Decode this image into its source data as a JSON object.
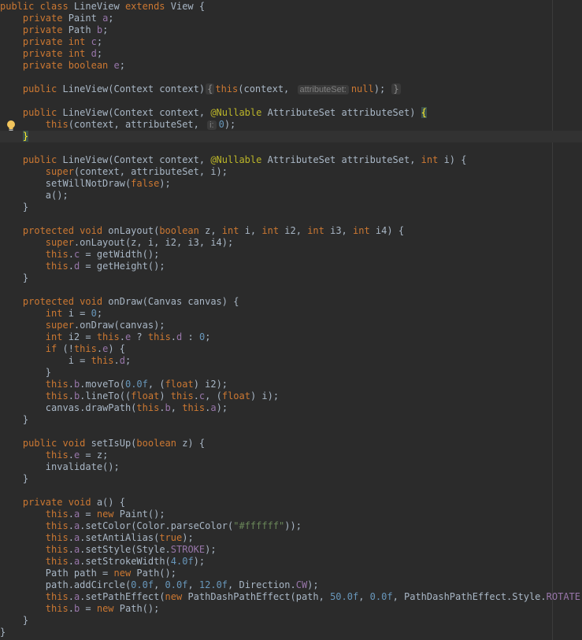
{
  "editor": {
    "hint_icon": "lightbulb-icon",
    "lines": [
      {
        "segs": [
          {
            "t": "public class ",
            "c": "kw"
          },
          {
            "t": "LineView "
          },
          {
            "t": "extends ",
            "c": "kw"
          },
          {
            "t": "View {"
          }
        ]
      },
      {
        "segs": [
          {
            "t": "    "
          },
          {
            "t": "private ",
            "c": "kw"
          },
          {
            "t": "Paint "
          },
          {
            "t": "a",
            "c": "fld"
          },
          {
            "t": ";"
          }
        ]
      },
      {
        "segs": [
          {
            "t": "    "
          },
          {
            "t": "private ",
            "c": "kw"
          },
          {
            "t": "Path "
          },
          {
            "t": "b",
            "c": "fld"
          },
          {
            "t": ";"
          }
        ]
      },
      {
        "segs": [
          {
            "t": "    "
          },
          {
            "t": "private int ",
            "c": "kw"
          },
          {
            "t": "c",
            "c": "fld"
          },
          {
            "t": ";"
          }
        ]
      },
      {
        "segs": [
          {
            "t": "    "
          },
          {
            "t": "private int ",
            "c": "kw"
          },
          {
            "t": "d",
            "c": "fld"
          },
          {
            "t": ";"
          }
        ]
      },
      {
        "segs": [
          {
            "t": "    "
          },
          {
            "t": "private boolean ",
            "c": "kw"
          },
          {
            "t": "e",
            "c": "fld"
          },
          {
            "t": ";"
          }
        ]
      },
      {
        "segs": []
      },
      {
        "segs": [
          {
            "t": "    "
          },
          {
            "t": "public ",
            "c": "kw"
          },
          {
            "t": "LineView(Context context)"
          },
          {
            "t": "{",
            "c": "fold"
          },
          {
            "t": "this",
            "c": "kw"
          },
          {
            "t": "(context, "
          },
          {
            "t": "attributeSet:",
            "c": "hint"
          },
          {
            "t": "null",
            "c": "kw"
          },
          {
            "t": "); "
          },
          {
            "t": "}",
            "c": "fold"
          }
        ]
      },
      {
        "segs": []
      },
      {
        "segs": [
          {
            "t": "    "
          },
          {
            "t": "public ",
            "c": "kw"
          },
          {
            "t": "LineView(Context context, "
          },
          {
            "t": "@Nullable ",
            "c": "ann"
          },
          {
            "t": "AttributeSet attributeSet) "
          },
          {
            "t": "{",
            "c": "brace-hl"
          }
        ]
      },
      {
        "segs": [
          {
            "t": "        "
          },
          {
            "t": "this",
            "c": "kw"
          },
          {
            "t": "(context, attributeSet, "
          },
          {
            "t": "i:",
            "c": "hint"
          },
          {
            "t": "0",
            "c": "num"
          },
          {
            "t": ");"
          }
        ]
      },
      {
        "segs": [
          {
            "t": "    "
          },
          {
            "t": "}",
            "c": "brace-hl"
          }
        ],
        "current": true
      },
      {
        "segs": []
      },
      {
        "segs": [
          {
            "t": "    "
          },
          {
            "t": "public ",
            "c": "kw"
          },
          {
            "t": "LineView(Context context, "
          },
          {
            "t": "@Nullable ",
            "c": "ann"
          },
          {
            "t": "AttributeSet attributeSet, "
          },
          {
            "t": "int ",
            "c": "kw"
          },
          {
            "t": "i) {"
          }
        ]
      },
      {
        "segs": [
          {
            "t": "        "
          },
          {
            "t": "super",
            "c": "kw"
          },
          {
            "t": "(context, attributeSet, i);"
          }
        ]
      },
      {
        "segs": [
          {
            "t": "        "
          },
          {
            "t": "setWillNotDraw("
          },
          {
            "t": "false",
            "c": "kw"
          },
          {
            "t": ");"
          }
        ]
      },
      {
        "segs": [
          {
            "t": "        "
          },
          {
            "t": "a();"
          }
        ]
      },
      {
        "segs": [
          {
            "t": "    }"
          }
        ]
      },
      {
        "segs": []
      },
      {
        "segs": [
          {
            "t": "    "
          },
          {
            "t": "protected void ",
            "c": "kw"
          },
          {
            "t": "onLayout("
          },
          {
            "t": "boolean ",
            "c": "kw"
          },
          {
            "t": "z, "
          },
          {
            "t": "int ",
            "c": "kw"
          },
          {
            "t": "i, "
          },
          {
            "t": "int ",
            "c": "kw"
          },
          {
            "t": "i2, "
          },
          {
            "t": "int ",
            "c": "kw"
          },
          {
            "t": "i3, "
          },
          {
            "t": "int ",
            "c": "kw"
          },
          {
            "t": "i4) {"
          }
        ]
      },
      {
        "segs": [
          {
            "t": "        "
          },
          {
            "t": "super",
            "c": "kw"
          },
          {
            "t": ".onLayout(z, i, i2, i3, i4);"
          }
        ]
      },
      {
        "segs": [
          {
            "t": "        "
          },
          {
            "t": "this",
            "c": "kw"
          },
          {
            "t": "."
          },
          {
            "t": "c",
            "c": "fld"
          },
          {
            "t": " = getWidth();"
          }
        ]
      },
      {
        "segs": [
          {
            "t": "        "
          },
          {
            "t": "this",
            "c": "kw"
          },
          {
            "t": "."
          },
          {
            "t": "d",
            "c": "fld"
          },
          {
            "t": " = getHeight();"
          }
        ]
      },
      {
        "segs": [
          {
            "t": "    }"
          }
        ]
      },
      {
        "segs": []
      },
      {
        "segs": [
          {
            "t": "    "
          },
          {
            "t": "protected void ",
            "c": "kw"
          },
          {
            "t": "onDraw(Canvas canvas) {"
          }
        ]
      },
      {
        "segs": [
          {
            "t": "        "
          },
          {
            "t": "int ",
            "c": "kw"
          },
          {
            "t": "i = "
          },
          {
            "t": "0",
            "c": "num"
          },
          {
            "t": ";"
          }
        ]
      },
      {
        "segs": [
          {
            "t": "        "
          },
          {
            "t": "super",
            "c": "kw"
          },
          {
            "t": ".onDraw(canvas);"
          }
        ]
      },
      {
        "segs": [
          {
            "t": "        "
          },
          {
            "t": "int ",
            "c": "kw"
          },
          {
            "t": "i2 = "
          },
          {
            "t": "this",
            "c": "kw"
          },
          {
            "t": "."
          },
          {
            "t": "e",
            "c": "fld"
          },
          {
            "t": " ? "
          },
          {
            "t": "this",
            "c": "kw"
          },
          {
            "t": "."
          },
          {
            "t": "d",
            "c": "fld"
          },
          {
            "t": " : "
          },
          {
            "t": "0",
            "c": "num"
          },
          {
            "t": ";"
          }
        ]
      },
      {
        "segs": [
          {
            "t": "        "
          },
          {
            "t": "if ",
            "c": "kw"
          },
          {
            "t": "(!"
          },
          {
            "t": "this",
            "c": "kw"
          },
          {
            "t": "."
          },
          {
            "t": "e",
            "c": "fld"
          },
          {
            "t": ") {"
          }
        ]
      },
      {
        "segs": [
          {
            "t": "            i = "
          },
          {
            "t": "this",
            "c": "kw"
          },
          {
            "t": "."
          },
          {
            "t": "d",
            "c": "fld"
          },
          {
            "t": ";"
          }
        ]
      },
      {
        "segs": [
          {
            "t": "        }"
          }
        ]
      },
      {
        "segs": [
          {
            "t": "        "
          },
          {
            "t": "this",
            "c": "kw"
          },
          {
            "t": "."
          },
          {
            "t": "b",
            "c": "fld"
          },
          {
            "t": ".moveTo("
          },
          {
            "t": "0.0f",
            "c": "num"
          },
          {
            "t": ", ("
          },
          {
            "t": "float",
            "c": "kw"
          },
          {
            "t": ") i2);"
          }
        ]
      },
      {
        "segs": [
          {
            "t": "        "
          },
          {
            "t": "this",
            "c": "kw"
          },
          {
            "t": "."
          },
          {
            "t": "b",
            "c": "fld"
          },
          {
            "t": ".lineTo(("
          },
          {
            "t": "float",
            "c": "kw"
          },
          {
            "t": ") "
          },
          {
            "t": "this",
            "c": "kw"
          },
          {
            "t": "."
          },
          {
            "t": "c",
            "c": "fld"
          },
          {
            "t": ", ("
          },
          {
            "t": "float",
            "c": "kw"
          },
          {
            "t": ") i);"
          }
        ]
      },
      {
        "segs": [
          {
            "t": "        canvas.drawPath("
          },
          {
            "t": "this",
            "c": "kw"
          },
          {
            "t": "."
          },
          {
            "t": "b",
            "c": "fld"
          },
          {
            "t": ", "
          },
          {
            "t": "this",
            "c": "kw"
          },
          {
            "t": "."
          },
          {
            "t": "a",
            "c": "fld"
          },
          {
            "t": ");"
          }
        ]
      },
      {
        "segs": [
          {
            "t": "    }"
          }
        ]
      },
      {
        "segs": []
      },
      {
        "segs": [
          {
            "t": "    "
          },
          {
            "t": "public void ",
            "c": "kw"
          },
          {
            "t": "setIsUp("
          },
          {
            "t": "boolean ",
            "c": "kw"
          },
          {
            "t": "z) {"
          }
        ]
      },
      {
        "segs": [
          {
            "t": "        "
          },
          {
            "t": "this",
            "c": "kw"
          },
          {
            "t": "."
          },
          {
            "t": "e",
            "c": "fld"
          },
          {
            "t": " = z;"
          }
        ]
      },
      {
        "segs": [
          {
            "t": "        invalidate();"
          }
        ]
      },
      {
        "segs": [
          {
            "t": "    }"
          }
        ]
      },
      {
        "segs": []
      },
      {
        "segs": [
          {
            "t": "    "
          },
          {
            "t": "private void ",
            "c": "kw"
          },
          {
            "t": "a() {"
          }
        ]
      },
      {
        "segs": [
          {
            "t": "        "
          },
          {
            "t": "this",
            "c": "kw"
          },
          {
            "t": "."
          },
          {
            "t": "a",
            "c": "fld"
          },
          {
            "t": " = "
          },
          {
            "t": "new ",
            "c": "kw"
          },
          {
            "t": "Paint();"
          }
        ]
      },
      {
        "segs": [
          {
            "t": "        "
          },
          {
            "t": "this",
            "c": "kw"
          },
          {
            "t": "."
          },
          {
            "t": "a",
            "c": "fld"
          },
          {
            "t": ".setColor(Color.parseColor("
          },
          {
            "t": "\"#ffffff\"",
            "c": "str"
          },
          {
            "t": "));"
          }
        ]
      },
      {
        "segs": [
          {
            "t": "        "
          },
          {
            "t": "this",
            "c": "kw"
          },
          {
            "t": "."
          },
          {
            "t": "a",
            "c": "fld"
          },
          {
            "t": ".setAntiAlias("
          },
          {
            "t": "true",
            "c": "kw"
          },
          {
            "t": ");"
          }
        ]
      },
      {
        "segs": [
          {
            "t": "        "
          },
          {
            "t": "this",
            "c": "kw"
          },
          {
            "t": "."
          },
          {
            "t": "a",
            "c": "fld"
          },
          {
            "t": ".setStyle(Style."
          },
          {
            "t": "STROKE",
            "c": "fld"
          },
          {
            "t": ");"
          }
        ]
      },
      {
        "segs": [
          {
            "t": "        "
          },
          {
            "t": "this",
            "c": "kw"
          },
          {
            "t": "."
          },
          {
            "t": "a",
            "c": "fld"
          },
          {
            "t": ".setStrokeWidth("
          },
          {
            "t": "4.0f",
            "c": "num"
          },
          {
            "t": ");"
          }
        ]
      },
      {
        "segs": [
          {
            "t": "        Path path = "
          },
          {
            "t": "new ",
            "c": "kw"
          },
          {
            "t": "Path();"
          }
        ]
      },
      {
        "segs": [
          {
            "t": "        path.addCircle("
          },
          {
            "t": "0.0f",
            "c": "num"
          },
          {
            "t": ", "
          },
          {
            "t": "0.0f",
            "c": "num"
          },
          {
            "t": ", "
          },
          {
            "t": "12.0f",
            "c": "num"
          },
          {
            "t": ", Direction."
          },
          {
            "t": "CW",
            "c": "fld"
          },
          {
            "t": ");"
          }
        ]
      },
      {
        "segs": [
          {
            "t": "        "
          },
          {
            "t": "this",
            "c": "kw"
          },
          {
            "t": "."
          },
          {
            "t": "a",
            "c": "fld"
          },
          {
            "t": ".setPathEffect("
          },
          {
            "t": "new ",
            "c": "kw"
          },
          {
            "t": "PathDashPathEffect(path, "
          },
          {
            "t": "50.0f",
            "c": "num"
          },
          {
            "t": ", "
          },
          {
            "t": "0.0f",
            "c": "num"
          },
          {
            "t": ", PathDashPathEffect.Style."
          },
          {
            "t": "ROTATE",
            "c": "fld"
          },
          {
            "t": "));"
          }
        ]
      },
      {
        "segs": [
          {
            "t": "        "
          },
          {
            "t": "this",
            "c": "kw"
          },
          {
            "t": "."
          },
          {
            "t": "b",
            "c": "fld"
          },
          {
            "t": " = "
          },
          {
            "t": "new ",
            "c": "kw"
          },
          {
            "t": "Path();"
          }
        ]
      },
      {
        "segs": [
          {
            "t": "    }"
          }
        ]
      },
      {
        "segs": [
          {
            "t": "}"
          }
        ]
      }
    ]
  }
}
